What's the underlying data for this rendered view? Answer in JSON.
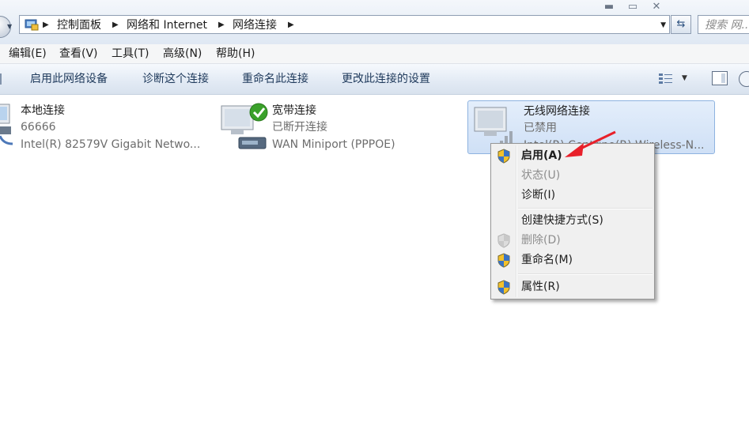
{
  "address_bar": {
    "breadcrumbs": [
      "控制面板",
      "网络和 Internet",
      "网络连接"
    ],
    "search_placeholder": "搜索 网..."
  },
  "menubar": {
    "items": [
      "编辑(E)",
      "查看(V)",
      "工具(T)",
      "高级(N)",
      "帮助(H)"
    ]
  },
  "commandbar": {
    "items": [
      "启用此网络设备",
      "诊断这个连接",
      "重命名此连接",
      "更改此连接的设置"
    ]
  },
  "connections": [
    {
      "name": "本地连接",
      "status": "66666",
      "device": "Intel(R) 82579V Gigabit Netwo..."
    },
    {
      "name": "宽带连接",
      "status": "已断开连接",
      "device": "WAN Miniport (PPPOE)"
    },
    {
      "name": "无线网络连接",
      "status": "已禁用",
      "device": "Intel(R) Centrino(R) Wireless-N..."
    }
  ],
  "context_menu": {
    "items": [
      {
        "label": "启用(A)",
        "icon": "uac-shield-icon",
        "state": "default"
      },
      {
        "label": "状态(U)",
        "icon": "",
        "state": "disabled"
      },
      {
        "label": "诊断(I)",
        "icon": "",
        "state": "normal"
      },
      {
        "label": "创建快捷方式(S)",
        "icon": "",
        "state": "normal"
      },
      {
        "label": "删除(D)",
        "icon": "uac-shield-icon",
        "state": "disabled"
      },
      {
        "label": "重命名(M)",
        "icon": "uac-shield-icon",
        "state": "normal"
      },
      {
        "label": "属性(R)",
        "icon": "uac-shield-icon",
        "state": "normal"
      }
    ]
  },
  "annotation": {
    "color": "#e8202a",
    "points_to": "启用(A)"
  },
  "colors": {
    "selection": "#cfe0f6",
    "success": "#3aa12a",
    "command_text": "#1e395b"
  }
}
